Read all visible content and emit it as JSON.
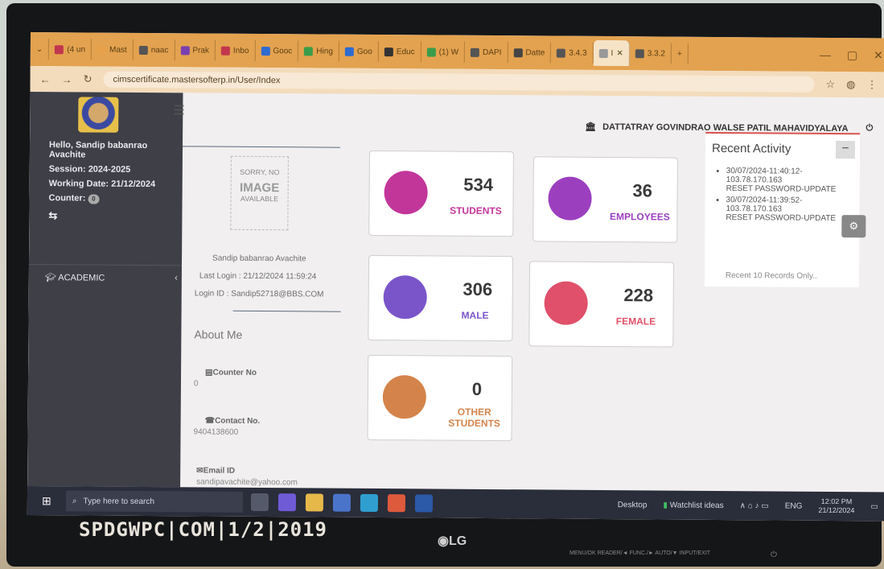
{
  "browser": {
    "tabs": [
      {
        "label": "(4 un",
        "color": "#c2364e"
      },
      {
        "label": "Mast",
        "color": "#e6a14a"
      },
      {
        "label": "naac",
        "color": "#555555"
      },
      {
        "label": "Prak",
        "color": "#7a3fb0"
      },
      {
        "label": "Inbo",
        "color": "#c2364e"
      },
      {
        "label": "Gooc",
        "color": "#2d6bd1"
      },
      {
        "label": "Hing",
        "color": "#3a9c4a"
      },
      {
        "label": "Goo",
        "color": "#2d6bd1"
      },
      {
        "label": "Educ",
        "color": "#333333"
      },
      {
        "label": "(1) W",
        "color": "#3a9c4a"
      },
      {
        "label": "DAPI",
        "color": "#555555"
      },
      {
        "label": "Datte",
        "color": "#444444"
      },
      {
        "label": "3.4.3",
        "color": "#555555"
      },
      {
        "label": "I",
        "color": "#999999"
      },
      {
        "label": "3.3.2",
        "color": "#555555"
      }
    ],
    "new_tab": "+",
    "url": "cimscertificate.mastersofterp.in/User/Index"
  },
  "sidebar": {
    "greeting": "Hello, Sandip babanrao Avachite",
    "session": "Session: 2024-2025",
    "working_date": "Working Date: 21/12/2024",
    "counter_label": "Counter:",
    "counter_value": "0",
    "menu": [
      {
        "label": "ACADEMIC",
        "icon": "graduation-cap-icon"
      }
    ]
  },
  "header": {
    "college": "DATTATRAY GOVINDRAO WALSE PATIL MAHAVIDYALAYA"
  },
  "profile": {
    "no_image_top": "SORRY, NO",
    "no_image_mid": "IMAGE",
    "no_image_bottom": "AVAILABLE",
    "name": "Sandip babanrao Avachite",
    "last_login": "Last Login : 21/12/2024 11:59:24",
    "login_id": "Login ID : Sandip52718@BBS.COM",
    "about": "About Me",
    "counter_label": "Counter No",
    "counter_value": "0",
    "contact_label": "Contact No.",
    "contact_value": "9404138600",
    "email_label": "Email ID",
    "email_value": "sandipavachite@yahoo.com"
  },
  "stats": {
    "students": {
      "value": "534",
      "label": "STUDENTS",
      "color": "#c2369a"
    },
    "employees": {
      "value": "36",
      "label": "EMPLOYEES",
      "color": "#9b3fbf"
    },
    "male": {
      "value": "306",
      "label": "MALE",
      "color": "#7a55c9"
    },
    "female": {
      "value": "228",
      "label": "FEMALE",
      "color": "#e0506a"
    },
    "other_value": "0",
    "other_label1": "OTHER",
    "other_label2": "STUDENTS",
    "other_color": "#d4844a"
  },
  "recent": {
    "title": "Recent Activity",
    "items": [
      {
        "line1": "30/07/2024-11:40:12-",
        "line2": "103.78.170.163",
        "line3": "RESET PASSWORD-UPDATE"
      },
      {
        "line1": "30/07/2024-11:39:52-",
        "line2": "103.78.170.163",
        "line3": "RESET PASSWORD-UPDATE"
      }
    ],
    "note": "Recent 10 Records Only.."
  },
  "taskbar": {
    "search_placeholder": "Type here to search",
    "desktop": "Desktop",
    "watchlist": "Watchlist ideas",
    "lang": "ENG",
    "time": "12:02 PM",
    "date": "21/12/2024"
  },
  "bezel": {
    "handwriting": "SPDGWPC|COM|1/2|2019",
    "brand": "LG",
    "buttons": "MENU/OK   READER/◄   FUNC./►   AUTO/▼   INPUT/EXIT"
  }
}
